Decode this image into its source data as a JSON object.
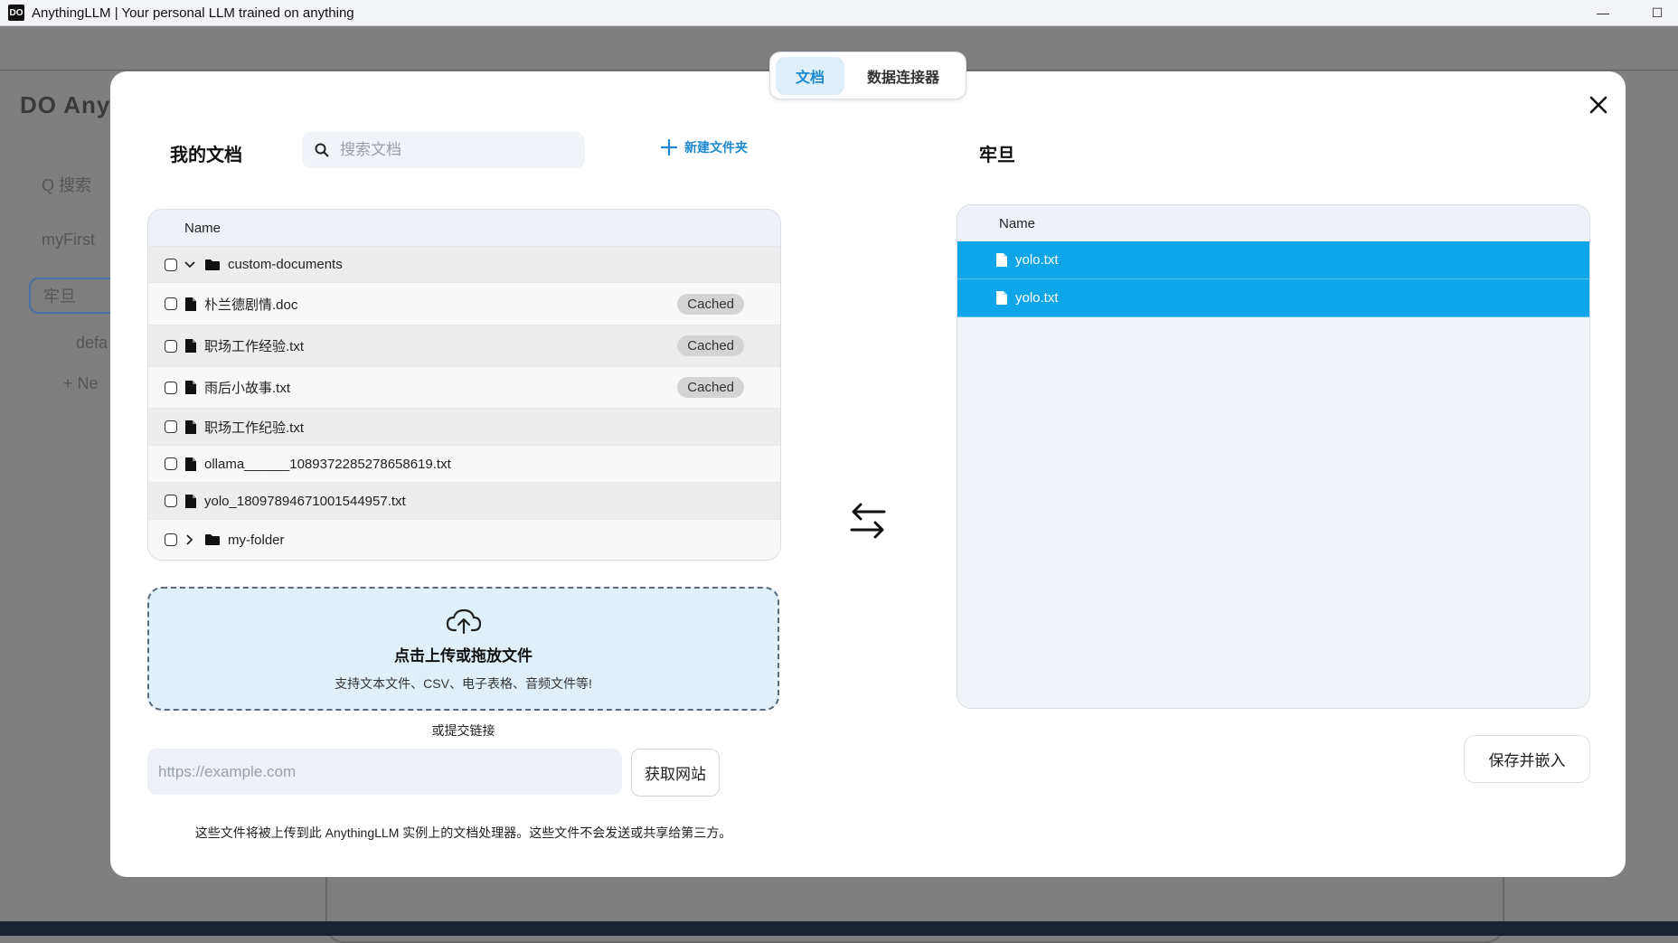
{
  "window": {
    "title": "AnythingLLM | Your personal LLM trained on anything",
    "logo_text": "DO",
    "minimize_glyph": "—",
    "maximize_glyph": "☐"
  },
  "background_app": {
    "logo_text": "DO Anyth",
    "items": [
      "Q 搜索",
      "myFirst",
      "牢旦",
      "defa",
      "+ Ne"
    ]
  },
  "tabs": [
    {
      "label": "文档",
      "active": true
    },
    {
      "label": "数据连接器",
      "active": false
    }
  ],
  "left_panel": {
    "title": "我的文档",
    "search_placeholder": "搜索文档",
    "new_folder_label": "新建文件夹",
    "column_name": "Name",
    "rows": [
      {
        "name": "custom-documents",
        "type": "folder",
        "expanded": true,
        "badge": ""
      },
      {
        "name": "朴兰德剧情.doc",
        "type": "file",
        "badge": "Cached"
      },
      {
        "name": "职场工作经验.txt",
        "type": "file",
        "badge": "Cached"
      },
      {
        "name": "雨后小故事.txt",
        "type": "file",
        "badge": "Cached"
      },
      {
        "name": "职场工作纪验.txt",
        "type": "file",
        "badge": ""
      },
      {
        "name": "ollama______1089372285278658619.txt",
        "type": "file",
        "badge": ""
      },
      {
        "name": "yolo_1809789467100154495​7.txt",
        "type": "file",
        "badge": ""
      },
      {
        "name": "my-folder",
        "type": "folder",
        "expanded": false,
        "badge": ""
      }
    ]
  },
  "upload": {
    "title": "点击上传或拖放文件",
    "subtitle": "支持文本文件、CSV、电子表格、音频文件等!",
    "or_link_label": "或提交链接",
    "url_placeholder": "https://example.com",
    "fetch_button": "获取网站",
    "disclaimer": "这些文件将被上传到此 AnythingLLM 实例上的文档处理器。这些文件不会发送或共享给第三方。"
  },
  "right_panel": {
    "title": "牢旦",
    "column_name": "Name",
    "rows": [
      {
        "name": "yolo.txt"
      },
      {
        "name": "yolo.txt"
      }
    ],
    "save_button": "保存并嵌入"
  },
  "colors": {
    "accent": "#1e88d0",
    "selected_row": "#0ea5e9",
    "upload_bg": "#e0f0fb"
  }
}
